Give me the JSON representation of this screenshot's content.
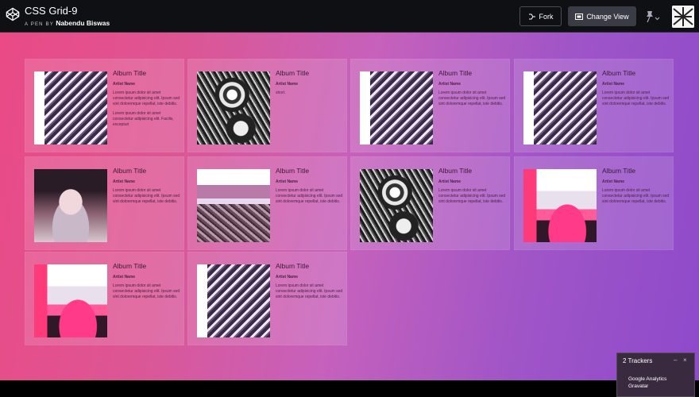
{
  "header": {
    "pen_title": "CSS Grid-9",
    "by_prefix": "A PEN BY",
    "author": "Nabendu Biswas",
    "fork_label": "Fork",
    "change_view_label": "Change View"
  },
  "cards": [
    {
      "title": "Album Title",
      "artist": "Artist Name",
      "desc": "Lorem ipsum dolor sit amet consectetur adipisicing elit. Ipsum sed sint doloremque repellat, iste debitis.",
      "desc2": "Lorem ipsum dolor sit amet consectetur adipisicing elit. Facilis, excepturi",
      "image": "building"
    },
    {
      "title": "Album Title",
      "artist": "Artist Name",
      "desc": "short.",
      "desc2": "",
      "image": "engine"
    },
    {
      "title": "Album Title",
      "artist": "Artist Name",
      "desc": "Lorem ipsum dolor sit amet consectetur adipisicing elit. Ipsum sed sint doloremque repellat, iste debitis.",
      "desc2": "",
      "image": "building"
    },
    {
      "title": "Album Title",
      "artist": "Artist Name",
      "desc": "Lorem ipsum dolor sit amet consectetur adipisicing elit. Ipsum sed sint doloremque repellat, iste debitis.",
      "desc2": "",
      "image": "building"
    },
    {
      "title": "Album Title",
      "artist": "Artist Name",
      "desc": "Lorem ipsum dolor sit amet consectetur adipisicing elit. Ipsum sed sint doloremque repellat, iste debitis.",
      "desc2": "",
      "image": "person"
    },
    {
      "title": "Album Title",
      "artist": "Artist Name",
      "desc": "Lorem ipsum dolor sit amet consectetur adipisicing elit. Ipsum sed sint doloremque repellat, iste debitis.",
      "desc2": "",
      "image": "bike"
    },
    {
      "title": "Album Title",
      "artist": "Artist Name",
      "desc": "Lorem ipsum dolor sit amet consectetur adipisicing elit. Ipsum sed sint doloremque repellat, iste debitis.",
      "desc2": "",
      "image": "engine"
    },
    {
      "title": "Album Title",
      "artist": "Artist Name",
      "desc": "Lorem ipsum dolor sit amet consectetur adipisicing elit. Ipsum sed sint doloremque repellat, iste debitis.",
      "desc2": "",
      "image": "neon"
    },
    {
      "title": "Album Title",
      "artist": "Artist Name",
      "desc": "Lorem ipsum dolor sit amet consectetur adipisicing elit. Ipsum sed sint doloremque repellat, iste debitis.",
      "desc2": "",
      "image": "neon"
    },
    {
      "title": "Album Title",
      "artist": "Artist Name",
      "desc": "Lorem ipsum dolor sit amet consectetur adipisicing elit. Ipsum sed sint doloremque repellat, iste debitis.",
      "desc2": "",
      "image": "building"
    }
  ],
  "trackers": {
    "title": "2 Trackers",
    "minimize_glyph": "–",
    "close_glyph": "×",
    "items": [
      "Google Analytics",
      "Gravatar"
    ]
  },
  "colors": {
    "gradient_start": "#ea4a86",
    "gradient_end": "#8e4acb",
    "topbar": "#0f1013"
  },
  "icons": [
    "codepen-logo-icon",
    "fork-icon",
    "change-view-icon",
    "pin-icon",
    "avatar"
  ]
}
